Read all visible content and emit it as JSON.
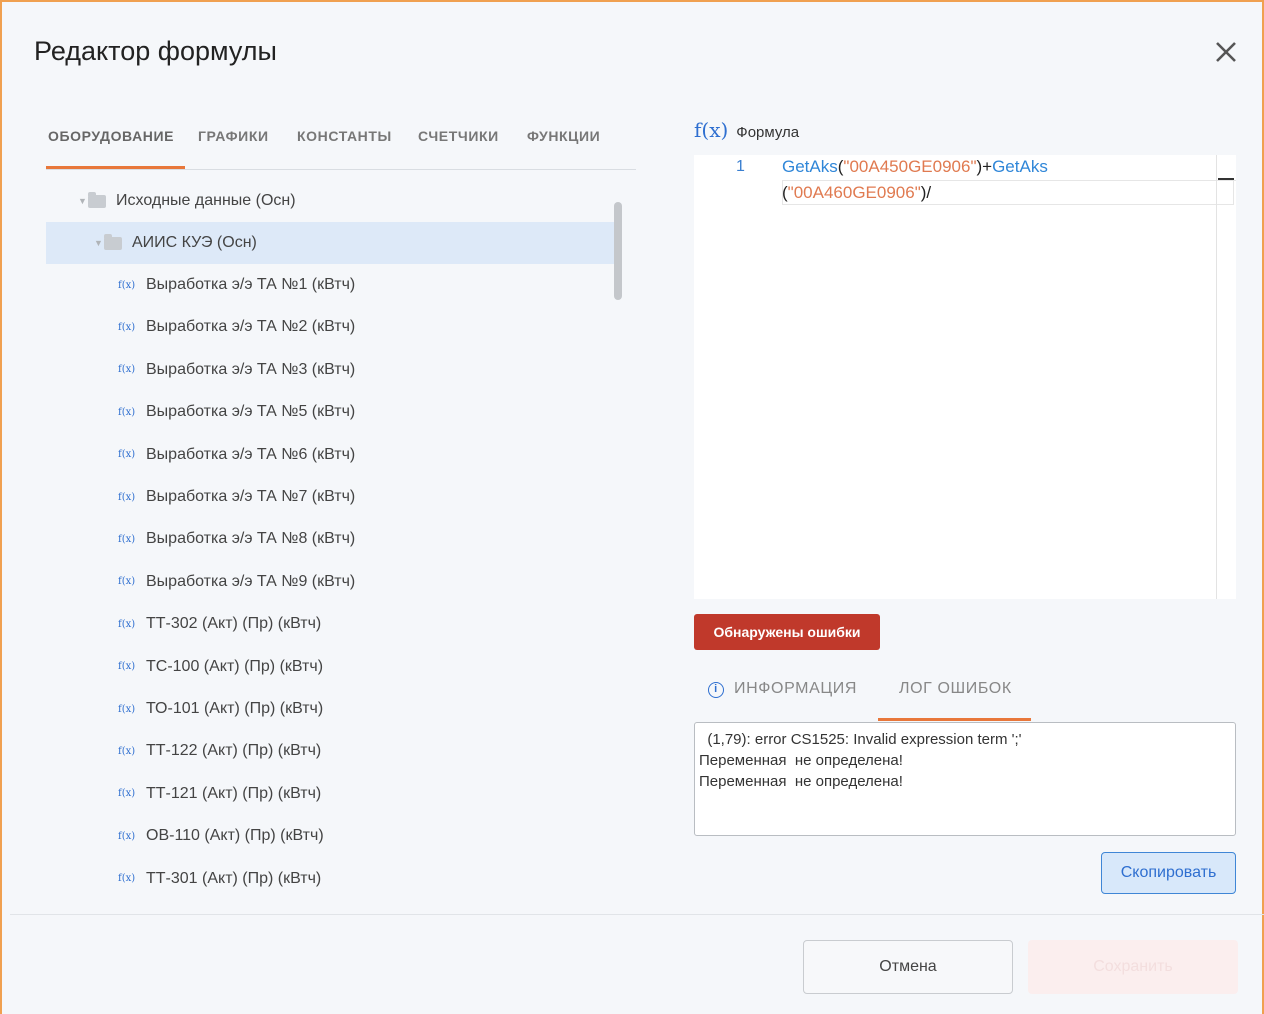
{
  "dialog": {
    "title": "Редактор формулы"
  },
  "tabs": [
    {
      "label": "ОБОРУДОВАНИЕ",
      "active": true
    },
    {
      "label": "ГРАФИКИ"
    },
    {
      "label": "КОНСТАНТЫ"
    },
    {
      "label": "СЧЕТЧИКИ"
    },
    {
      "label": "ФУНКЦИИ"
    }
  ],
  "tree": {
    "folders": [
      {
        "label": "Исходные данные (Осн)"
      },
      {
        "label": "АИИС КУЭ (Осн)",
        "selected": true
      }
    ],
    "fx_icon": "f(x)",
    "items": [
      "Выработка э/э ТА №1 (кВтч)",
      "Выработка э/э ТА №2 (кВтч)",
      "Выработка э/э ТА №3 (кВтч)",
      "Выработка э/э ТА №5 (кВтч)",
      "Выработка э/э ТА №6 (кВтч)",
      "Выработка э/э ТА №7 (кВтч)",
      "Выработка э/э ТА №8 (кВтч)",
      "Выработка э/э ТА №9 (кВтч)",
      "ТТ-302 (Акт) (Пр) (кВтч)",
      "ТС-100 (Акт) (Пр) (кВтч)",
      "ТО-101 (Акт) (Пр) (кВтч)",
      "ТТ-122 (Акт) (Пр) (кВтч)",
      "ТТ-121 (Акт) (Пр) (кВтч)",
      "ОВ-110 (Акт) (Пр) (кВтч)",
      "ТТ-301 (Акт) (Пр) (кВтч)"
    ]
  },
  "formula": {
    "icon": "f(x)",
    "label": "Формула",
    "line_number": "1",
    "line1": {
      "fn1": "GetAks",
      "p1": "(",
      "str1": "\"00A450GE0906\"",
      "p2": ")+",
      "fn2": "GetAks"
    },
    "line2": {
      "p1": "(",
      "str1": "\"00A460GE0906\"",
      "p2": ")/"
    }
  },
  "errors_badge": "Обнаружены ошибки",
  "sub_tabs": {
    "info_icon": "i",
    "info": "ИНФОРМАЦИЯ",
    "log": "ЛОГ ОШИБОК"
  },
  "log_lines": [
    "  (1,79): error CS1525: Invalid expression term ';'",
    "Переменная  не определена!",
    "Переменная  не определена!"
  ],
  "buttons": {
    "copy": "Скопировать",
    "cancel": "Отмена",
    "save": "Сохранить"
  },
  "colors": {
    "accent": "#e8773a",
    "link": "#2f6fd0",
    "error": "#c0392b",
    "string": "#e07a50"
  }
}
